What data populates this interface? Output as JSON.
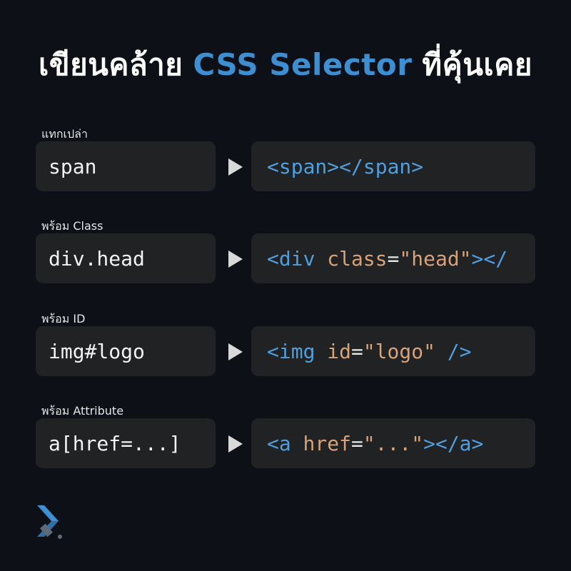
{
  "title": {
    "before": "เขียนคล้าย",
    "accent": "CSS Selector",
    "after": "ที่คุ้นเคย"
  },
  "rows": [
    {
      "label": "แทกเปล่า",
      "selector": "span",
      "output": {
        "t1": "<span></span>"
      }
    },
    {
      "label": "พร้อม Class",
      "selector": "div.head",
      "output": {
        "t1": "<div",
        "attr": "class",
        "eq": "=",
        "val": "\"head\"",
        "t2": "></"
      }
    },
    {
      "label": "พร้อม ID",
      "selector": "img#logo",
      "output": {
        "t1": "<img",
        "attr": "id",
        "eq": "=",
        "val": "\"logo\"",
        "t2": "/>"
      }
    },
    {
      "label": "พร้อม Attribute",
      "selector": "a[href=...]",
      "output": {
        "t1": "<a",
        "attr": "href",
        "eq": "=",
        "val": "\"...\"",
        "t2": "></a>"
      }
    }
  ],
  "colors": {
    "background": "#0d1016",
    "accent": "#3d8fd1",
    "tag": "#4f9fdf",
    "attribute": "#d7a27a",
    "box": "#212224"
  },
  "icons": {
    "logo": "brand-arrow-icon",
    "arrow": "play-triangle-icon"
  }
}
